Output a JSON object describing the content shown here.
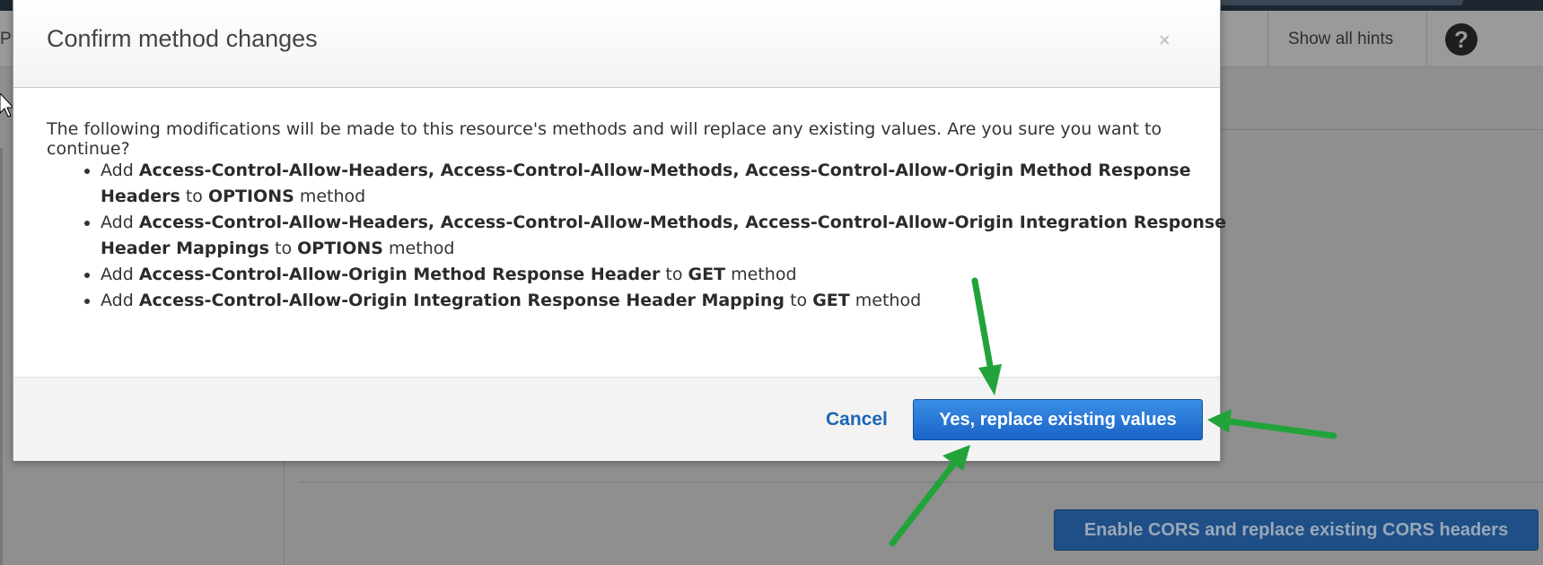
{
  "background": {
    "header_left_text": "Pl",
    "show_hints_label": "Show all hints",
    "help_icon_glyph": "?",
    "enable_cors_label": "Enable CORS and replace existing CORS headers"
  },
  "modal": {
    "title": "Confirm method changes",
    "close_glyph": "×",
    "intro": "The following modifications will be made to this resource's methods and will replace any existing values. Are you sure you want to continue?",
    "changes": [
      {
        "add": "Add",
        "headers": "Access-Control-Allow-Headers, Access-Control-Allow-Methods, Access-Control-Allow-Origin Method Response Headers",
        "to": "to",
        "method": "OPTIONS",
        "suffix": "method"
      },
      {
        "add": "Add",
        "headers": "Access-Control-Allow-Headers, Access-Control-Allow-Methods, Access-Control-Allow-Origin Integration Response Header Mappings",
        "to": "to",
        "method": "OPTIONS",
        "suffix": "method"
      },
      {
        "add": "Add",
        "headers": "Access-Control-Allow-Origin Method Response Header",
        "to": "to",
        "method": "GET",
        "suffix": "method"
      },
      {
        "add": "Add",
        "headers": "Access-Control-Allow-Origin Integration Response Header Mapping",
        "to": "to",
        "method": "GET",
        "suffix": "method"
      }
    ],
    "cancel_label": "Cancel",
    "confirm_label": "Yes, replace existing values"
  },
  "colors": {
    "primary_button": "#1a63c8",
    "link": "#1b66b3",
    "annotation_arrow": "#22a33a",
    "overlay": "#8f8f8f"
  }
}
